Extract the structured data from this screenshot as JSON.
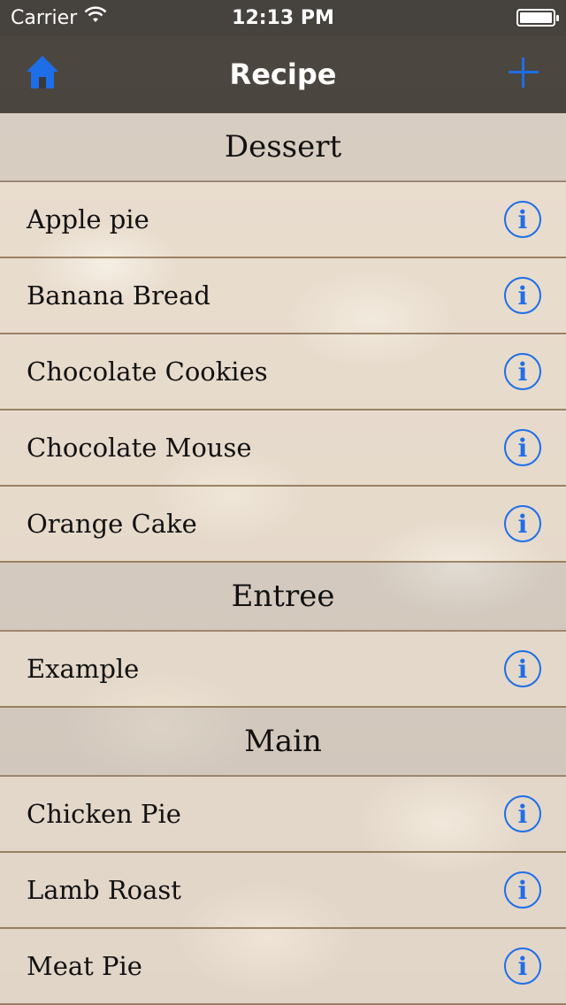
{
  "status_bar": {
    "carrier": "Carrier",
    "time": "12:13 PM",
    "battery_level": 1.0
  },
  "nav": {
    "title": "Recipe",
    "home_icon": "home-icon",
    "add_icon": "plus-icon",
    "accent": "#1e6ee8"
  },
  "sections": [
    {
      "title": "Dessert",
      "items": [
        "Apple pie",
        "Banana Bread",
        "Chocolate Cookies",
        "Chocolate Mouse",
        "Orange Cake"
      ]
    },
    {
      "title": "Entree",
      "items": [
        "Example"
      ]
    },
    {
      "title": "Main",
      "items": [
        "Chicken Pie",
        "Lamb Roast",
        "Meat Pie"
      ]
    }
  ],
  "info_glyph": "i"
}
